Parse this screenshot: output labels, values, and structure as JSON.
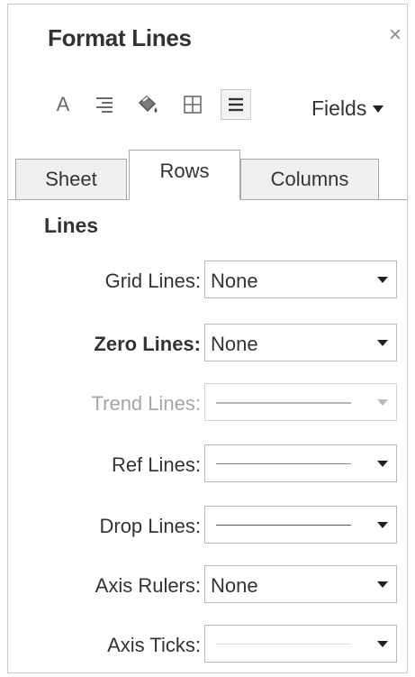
{
  "panel": {
    "title": "Format Lines",
    "close_glyph": "×"
  },
  "toolbar": {
    "tools": [
      {
        "icon": "font-icon",
        "glyph": "A"
      },
      {
        "icon": "align-icon"
      },
      {
        "icon": "shading-icon"
      },
      {
        "icon": "borders-icon"
      },
      {
        "icon": "lines-icon",
        "selected": true
      }
    ],
    "fields_label": "Fields"
  },
  "tabs": [
    {
      "label": "Sheet",
      "active": false
    },
    {
      "label": "Rows",
      "active": true
    },
    {
      "label": "Columns",
      "active": false
    }
  ],
  "section": {
    "title": "Lines"
  },
  "rows": [
    {
      "label": "Grid Lines:",
      "value": "None",
      "style": "normal"
    },
    {
      "label": "Zero Lines:",
      "value": "None",
      "style": "bold"
    },
    {
      "label": "Trend Lines:",
      "value": "",
      "style": "disabled",
      "line": "dimmed"
    },
    {
      "label": "Ref Lines:",
      "value": "",
      "style": "normal",
      "line": "thin"
    },
    {
      "label": "Drop Lines:",
      "value": "",
      "style": "normal",
      "line": "solid"
    },
    {
      "label": "Axis Rulers:",
      "value": "None",
      "style": "normal"
    },
    {
      "label": "Axis Ticks:",
      "value": "",
      "style": "normal",
      "line": "faint"
    }
  ],
  "colors": {
    "text": "#333333",
    "disabled_text": "#a6a6a6",
    "border": "#b9b9b9",
    "tab_bg": "#f0f0f0"
  }
}
